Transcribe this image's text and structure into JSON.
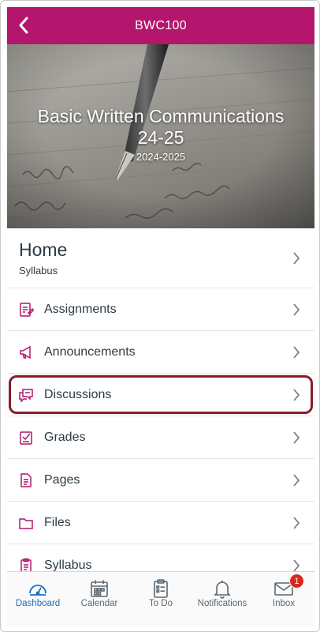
{
  "header": {
    "title": "BWC100",
    "bar_color": "#b3166c"
  },
  "hero": {
    "title": "Basic Written Communications 24-25",
    "term": "2024-2025"
  },
  "home": {
    "title": "Home",
    "subtitle": "Syllabus"
  },
  "menu": [
    {
      "label": "Assignments",
      "icon": "assignments-icon"
    },
    {
      "label": "Announcements",
      "icon": "announcements-icon"
    },
    {
      "label": "Discussions",
      "icon": "discussions-icon",
      "highlighted": true
    },
    {
      "label": "Grades",
      "icon": "grades-icon"
    },
    {
      "label": "Pages",
      "icon": "pages-icon"
    },
    {
      "label": "Files",
      "icon": "files-icon"
    },
    {
      "label": "Syllabus",
      "icon": "syllabus-icon"
    }
  ],
  "tabs": [
    {
      "label": "Dashboard",
      "icon": "dashboard-icon",
      "active": true
    },
    {
      "label": "Calendar",
      "icon": "calendar-icon"
    },
    {
      "label": "To Do",
      "icon": "todo-icon"
    },
    {
      "label": "Notifications",
      "icon": "bell-icon"
    },
    {
      "label": "Inbox",
      "icon": "inbox-icon",
      "badge": "1"
    }
  ],
  "colors": {
    "accent": "#b3166c",
    "active_tab": "#1d6ebf",
    "highlight_border": "#8a1c2c",
    "badge": "#d52b1e"
  }
}
